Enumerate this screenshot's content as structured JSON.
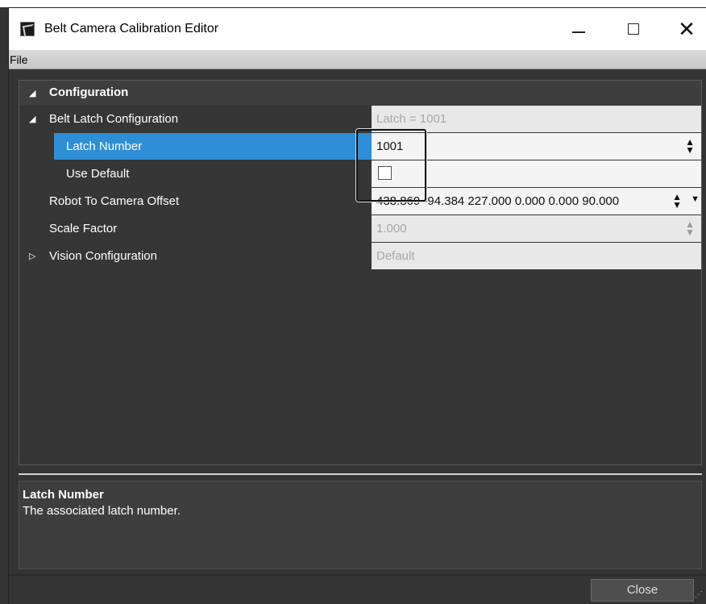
{
  "window": {
    "title": "Belt Camera Calibration Editor"
  },
  "menu": {
    "file": "File"
  },
  "grid": {
    "category": "Configuration",
    "rows": [
      {
        "label": "Belt Latch Configuration",
        "value": "Latch = 1001"
      },
      {
        "label": "Latch Number",
        "value": "1001"
      },
      {
        "label": "Use Default",
        "checked": false
      },
      {
        "label": "Robot To Camera Offset",
        "value": "438.869 -94.384 227.000 0.000 0.000 90.000"
      },
      {
        "label": "Scale Factor",
        "value": "1.000"
      },
      {
        "label": "Vision Configuration",
        "value": "Default"
      }
    ]
  },
  "description": {
    "title": "Latch Number",
    "text": "The associated latch number."
  },
  "buttons": {
    "close": "Close"
  },
  "icons": {
    "expanded": "triangle-down-icon",
    "collapsed": "triangle-right-icon",
    "spin": "spin-arrows-icon",
    "dropdown": "chevron-down-icon"
  },
  "colors": {
    "selection": "#2e8fd7",
    "background": "#363636"
  }
}
